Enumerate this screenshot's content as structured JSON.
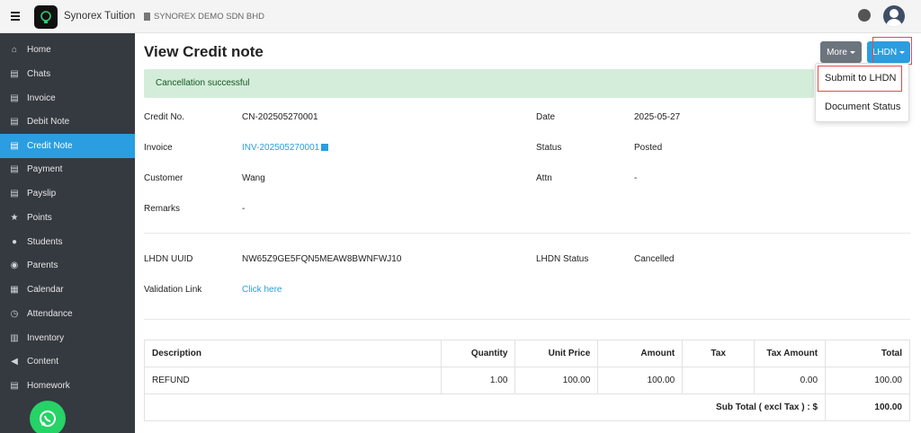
{
  "app": {
    "brand": "Synorex Tuition",
    "company": "SYNOREX DEMO SDN BHD"
  },
  "sidebar": {
    "items": [
      {
        "label": "Home",
        "icon": "home-icon"
      },
      {
        "label": "Chats",
        "icon": "document-icon"
      },
      {
        "label": "Invoice",
        "icon": "document-icon"
      },
      {
        "label": "Debit Note",
        "icon": "document-icon"
      },
      {
        "label": "Credit Note",
        "icon": "document-icon",
        "active": true
      },
      {
        "label": "Payment",
        "icon": "document-icon"
      },
      {
        "label": "Payslip",
        "icon": "document-icon"
      },
      {
        "label": "Points",
        "icon": "star-icon"
      },
      {
        "label": "Students",
        "icon": "users-icon"
      },
      {
        "label": "Parents",
        "icon": "user-circle-icon"
      },
      {
        "label": "Calendar",
        "icon": "calendar-icon"
      },
      {
        "label": "Attendance",
        "icon": "clock-icon"
      },
      {
        "label": "Inventory",
        "icon": "inventory-icon"
      },
      {
        "label": "Content",
        "icon": "megaphone-icon"
      },
      {
        "label": "Homework",
        "icon": "document-icon"
      }
    ]
  },
  "page": {
    "title": "View Credit note",
    "more_label": "More",
    "lhdn_label": "LHDN",
    "alert": "Cancellation successful",
    "dropdown": {
      "submit": "Submit to LHDN",
      "status": "Document Status"
    }
  },
  "details": {
    "credit_no_label": "Credit No.",
    "credit_no": "CN-202505270001",
    "date_label": "Date",
    "date": "2025-05-27",
    "invoice_label": "Invoice",
    "invoice": "INV-202505270001",
    "status_label": "Status",
    "status": "Posted",
    "customer_label": "Customer",
    "customer": "Wang",
    "attn_label": "Attn",
    "attn": "-",
    "remarks_label": "Remarks",
    "remarks": "-",
    "uuid_label": "LHDN UUID",
    "uuid": "NW65Z9GE5FQN5MEAW8BWNFWJ10",
    "lhdn_status_label": "LHDN Status",
    "lhdn_status": "Cancelled",
    "validation_label": "Validation Link",
    "validation_link": "Click here"
  },
  "table": {
    "headers": [
      "Description",
      "Quantity",
      "Unit Price",
      "Amount",
      "Tax",
      "Tax Amount",
      "Total"
    ],
    "rows": [
      [
        "REFUND",
        "1.00",
        "100.00",
        "100.00",
        "",
        "0.00",
        "100.00"
      ]
    ],
    "subtotal_label": "Sub Total ( excl Tax ) : $",
    "subtotal_value": "100.00"
  },
  "colors": {
    "sidebar_bg": "#343a40",
    "accent": "#2a9ee0",
    "alert_bg": "#d4edda",
    "highlight": "#e34a4a"
  }
}
